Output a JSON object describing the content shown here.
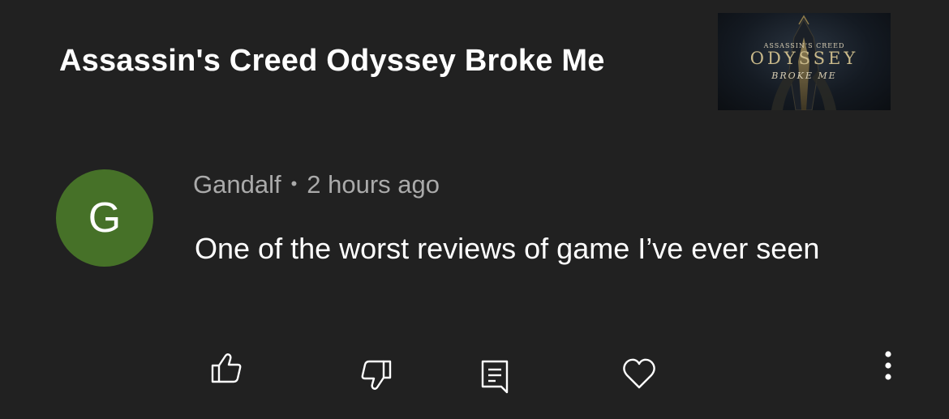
{
  "video": {
    "title": "Assassin's Creed Odyssey Broke Me",
    "thumbnail": {
      "line1": "ASSASSIN'S CREED",
      "line2": "ODYSSEY",
      "line3": "BROKE ME"
    }
  },
  "comment": {
    "avatar_letter": "G",
    "avatar_color": "#467128",
    "author": "Gandalf",
    "separator": "•",
    "time": "2 hours ago",
    "text": "One of the worst reviews of game I’ve ever seen"
  },
  "actions": {
    "like_icon": "thumbs-up-icon",
    "dislike_icon": "thumbs-down-icon",
    "reply_icon": "comment-icon",
    "heart_icon": "heart-icon",
    "more_icon": "more-vertical-icon"
  }
}
